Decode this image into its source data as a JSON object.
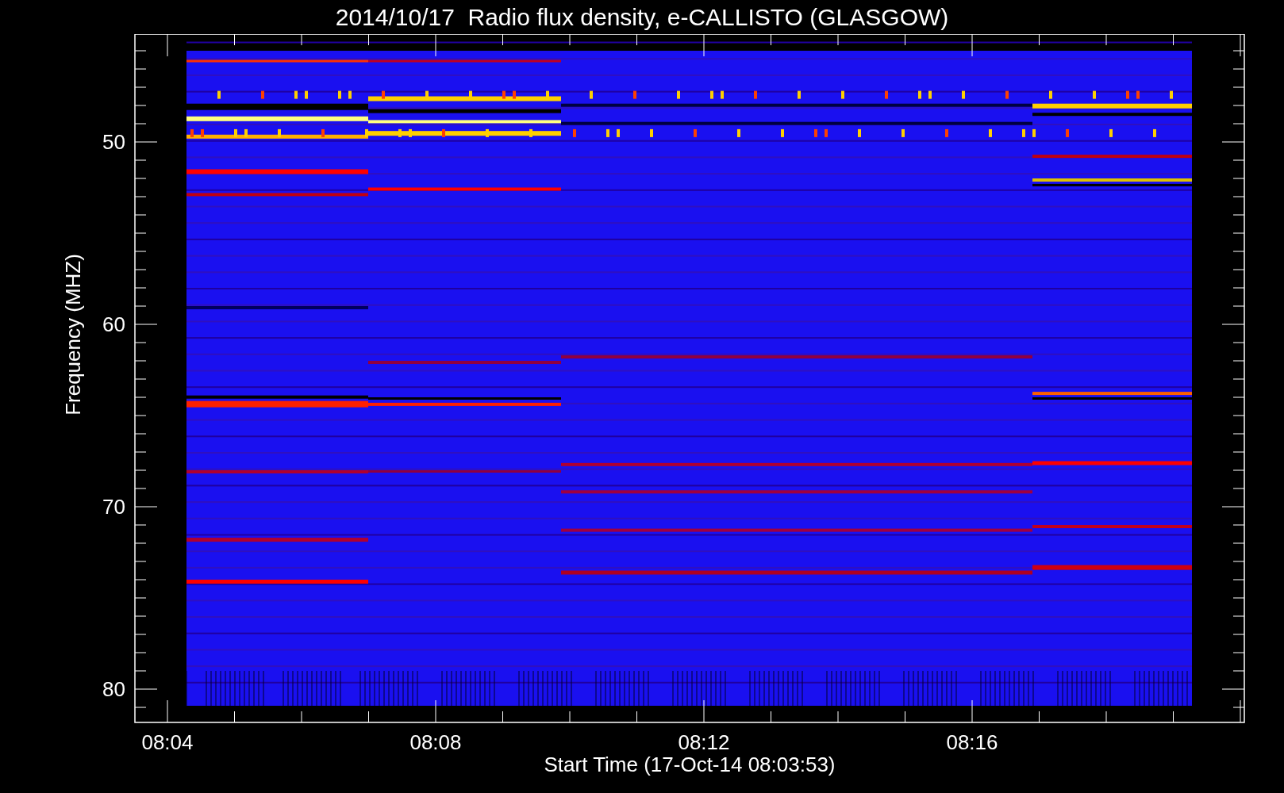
{
  "title": "2014/10/17  Radio flux density, e-CALLISTO (GLASGOW)",
  "y_axis": {
    "label": "Frequency (MHZ)",
    "ticks": [
      "50",
      "60",
      "70",
      "80"
    ]
  },
  "x_axis": {
    "label": "Start Time (17-Oct-14 08:03:53)",
    "ticks": [
      "08:04",
      "08:08",
      "08:12",
      "08:16"
    ]
  }
}
